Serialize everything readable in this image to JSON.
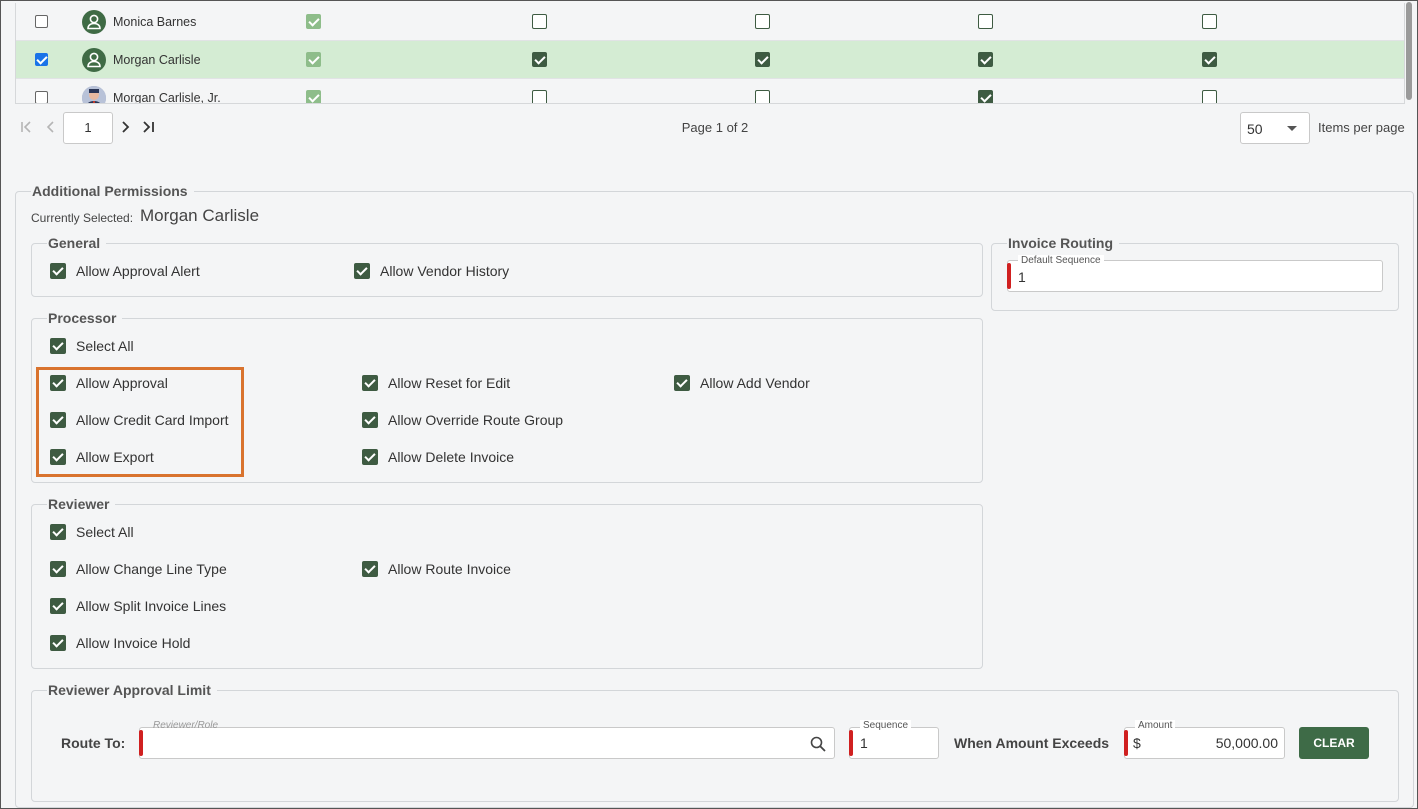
{
  "users": [
    {
      "name": "Monica Barnes",
      "row_checked": false,
      "selected": false,
      "avatar": "user-icon",
      "permissions": [
        true,
        false,
        false,
        false,
        false
      ]
    },
    {
      "name": "Morgan Carlisle",
      "row_checked": true,
      "selected": true,
      "avatar": "user-icon",
      "permissions": [
        true,
        true,
        true,
        true,
        true
      ]
    },
    {
      "name": "Morgan Carlisle, Jr.",
      "row_checked": false,
      "selected": false,
      "avatar": "photo-avatar",
      "permissions": [
        true,
        false,
        false,
        true,
        false
      ]
    }
  ],
  "paginator": {
    "page_input": "1",
    "page_text": "Page 1 of 2",
    "items_per_page_value": "50",
    "items_per_page_label": "Items per page"
  },
  "additional": {
    "legend": "Additional Permissions",
    "currently_selected_label": "Currently Selected:",
    "currently_selected_name": "Morgan Carlisle"
  },
  "general": {
    "legend": "General",
    "items": [
      {
        "label": "Allow Approval Alert",
        "checked": true
      },
      {
        "label": "Allow Vendor History",
        "checked": true
      }
    ]
  },
  "processor": {
    "legend": "Processor",
    "select_all": "Select All",
    "items": [
      {
        "label": "Allow Approval",
        "checked": true
      },
      {
        "label": "Allow Credit Card Import",
        "checked": true
      },
      {
        "label": "Allow Export",
        "checked": true
      },
      {
        "label": "Allow Reset for Edit",
        "checked": true
      },
      {
        "label": "Allow Override Route Group",
        "checked": true
      },
      {
        "label": "Allow Delete Invoice",
        "checked": true
      },
      {
        "label": "Allow Add Vendor",
        "checked": true
      }
    ]
  },
  "reviewer": {
    "legend": "Reviewer",
    "select_all": "Select All",
    "items": [
      {
        "label": "Allow Change Line Type",
        "checked": true
      },
      {
        "label": "Allow Split Invoice Lines",
        "checked": true
      },
      {
        "label": "Allow Invoice Hold",
        "checked": true
      },
      {
        "label": "Allow Route Invoice",
        "checked": true
      }
    ]
  },
  "invoice_routing": {
    "legend": "Invoice Routing",
    "default_sequence_label": "Default Sequence",
    "default_sequence_value": "1"
  },
  "approval_limit": {
    "legend": "Reviewer Approval Limit",
    "route_to_label": "Route To:",
    "reviewer_placeholder": "Reviewer/Role",
    "sequence_label": "Sequence",
    "sequence_value": "1",
    "when_exceeds_label": "When Amount Exceeds",
    "amount_label": "Amount",
    "currency_symbol": "$",
    "amount_value": "50,000.00",
    "clear_label": "CLEAR"
  },
  "colors": {
    "accent_green": "#3e5b42",
    "selected_row": "#d4ecd3",
    "highlight_box": "#d9732e",
    "required_marker": "#d02020"
  }
}
